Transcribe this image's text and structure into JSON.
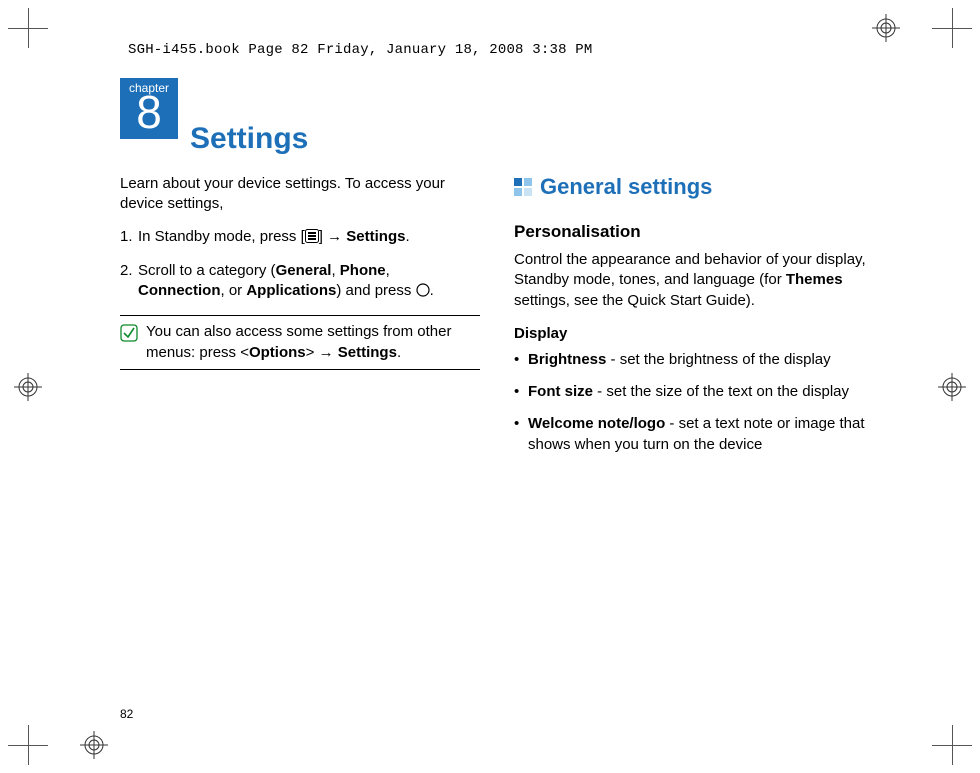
{
  "header_line": "SGH-i455.book  Page 82  Friday, January 18, 2008  3:38 PM",
  "chapter": {
    "label": "chapter",
    "number": "8",
    "title": "Settings"
  },
  "page_number": "82",
  "left": {
    "intro": "Learn about your device settings. To access your device settings,",
    "step1_a": "In Standby mode, press [",
    "step1_b": "] → ",
    "step1_bold": "Settings",
    "step1_c": ".",
    "step2_a": "Scroll to a category (",
    "step2_b1": "General",
    "step2_b2": "Phone",
    "step2_b3": "Connection",
    "step2_b4": "Applications",
    "step2_c": ") and press ",
    "step2_d": ".",
    "note_a": "You can also access some settings from other menus: press <",
    "note_b": "Options",
    "note_c": "> → ",
    "note_d": "Settings",
    "note_e": "."
  },
  "right": {
    "heading": "General settings",
    "pers_head": "Personalisation",
    "pers_a": "Control the appearance and behavior of your display, Standby mode, tones, and language (for ",
    "pers_bold": "Themes",
    "pers_b": " settings, see the Quick Start Guide).",
    "disp_head": "Display",
    "b1_bold": "Brightness",
    "b1_text": " - set the brightness of the display",
    "b2_bold": "Font size",
    "b2_text": " - set the size of the text on the display",
    "b3_bold": "Welcome note/logo",
    "b3_text": " - set a text note or image that shows when you turn on the device"
  }
}
